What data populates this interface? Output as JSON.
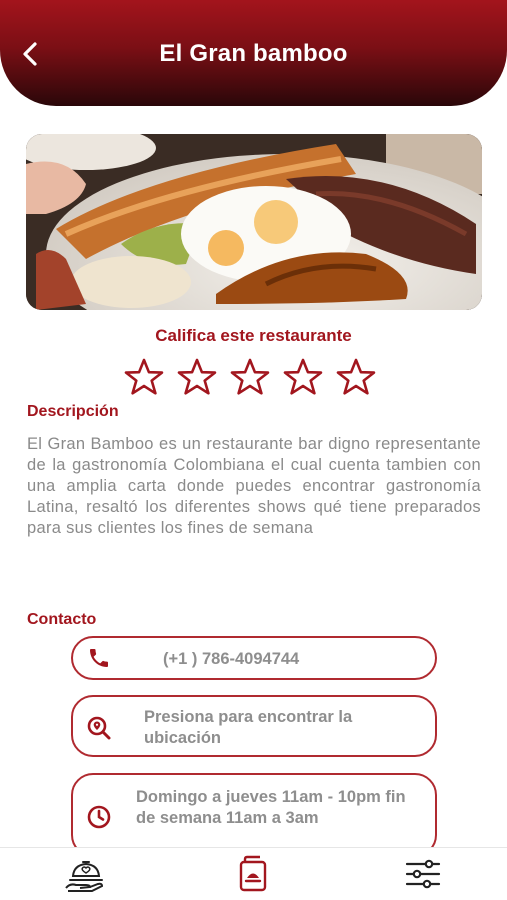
{
  "header": {
    "title": "El Gran bamboo",
    "back_icon": "chevron-left-icon"
  },
  "hero": {
    "image": "restaurant-dish-photo"
  },
  "rating": {
    "title": "Califica este restaurante",
    "stars_total": 5,
    "stars_selected": 0
  },
  "description": {
    "heading": "Descripción",
    "text": "El Gran Bamboo es un restaurante bar digno representante de la gastronomía Colombiana el cual cuenta tambien con una amplia carta donde puedes encontrar gastronomía Latina, resaltó los diferentes shows qué tiene preparados para sus clientes los fines de semana"
  },
  "contact": {
    "heading": "Contacto",
    "phone": {
      "icon": "phone-icon",
      "text": "(+1 ) 786-4094744"
    },
    "location": {
      "icon": "location-search-icon",
      "text": "Presiona para encontrar la ubicación"
    },
    "hours": {
      "icon": "clock-icon",
      "text": "Domingo a jueves 11am - 10pm fin de semana 11am a 3am"
    }
  },
  "navbar": {
    "items": [
      {
        "name": "menu-dish",
        "icon": "cloche-dish-icon"
      },
      {
        "name": "reservations",
        "icon": "booking-card-icon",
        "active": true
      },
      {
        "name": "filters",
        "icon": "sliders-icon"
      }
    ]
  },
  "colors": {
    "accent": "#a2161e",
    "header_dark": "#2a0709",
    "text_gray": "#8a8a8a"
  }
}
